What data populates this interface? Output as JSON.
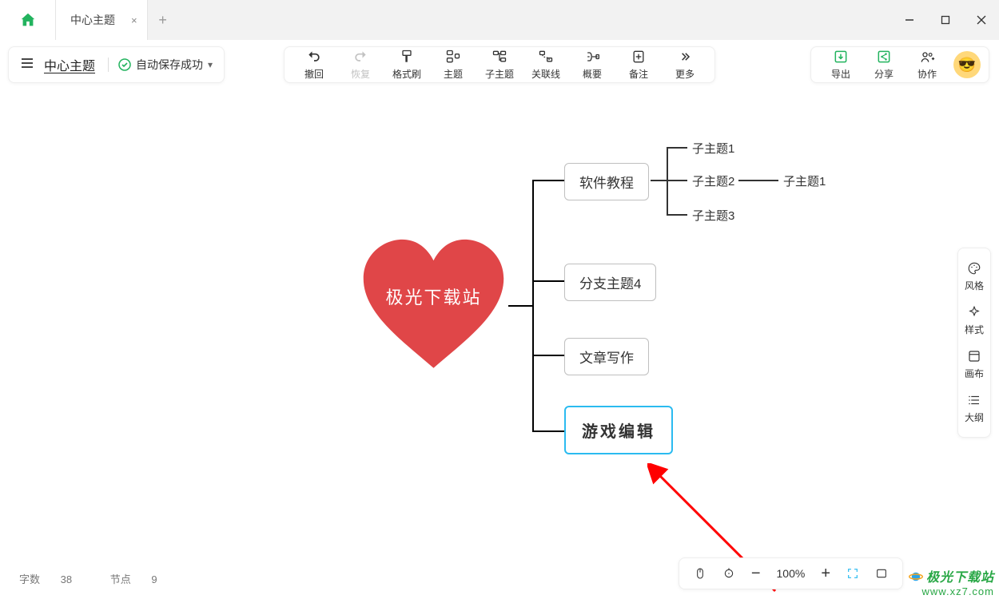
{
  "tabs": {
    "doc_title": "中心主题",
    "close_glyph": "×",
    "add_glyph": "+"
  },
  "doc": {
    "title": "中心主题",
    "save_status": "自动保存成功"
  },
  "toolbar": {
    "undo": "撤回",
    "redo": "恢复",
    "format": "格式刷",
    "topic": "主题",
    "subtopic": "子主题",
    "relation": "关联线",
    "summary": "概要",
    "note": "备注",
    "more": "更多"
  },
  "right_tools": {
    "export": "导出",
    "share": "分享",
    "collab": "协作"
  },
  "side": {
    "style": "风格",
    "format": "样式",
    "canvas": "画布",
    "outline": "大纲"
  },
  "status": {
    "words_label": "字数",
    "words": "38",
    "nodes_label": "节点",
    "nodes": "9"
  },
  "zoom": {
    "pct": "100%"
  },
  "mindmap": {
    "center": "极光下载站",
    "b1": "软件教程",
    "b2": "分支主题4",
    "b3": "文章写作",
    "b4": "游戏编辑",
    "c1": "子主题1",
    "c2": "子主题2",
    "c3": "子主题3",
    "d1": "子主题1"
  },
  "watermark": {
    "l1": "极光下载站",
    "l2": "www.xz7.com"
  }
}
